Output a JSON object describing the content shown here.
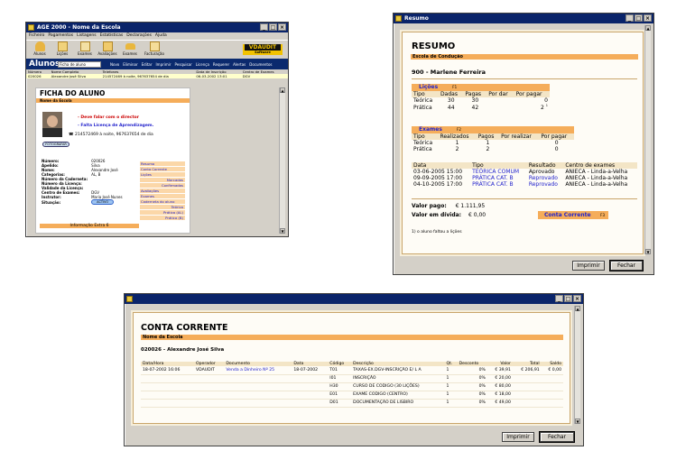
{
  "main": {
    "title": "AGE 2000 - Nome da Escola",
    "menu": [
      "Ficheiro",
      "Pagamentos",
      "Listagens",
      "Estatísticas",
      "Declarações",
      "Ajuda"
    ],
    "toolbar": [
      "Alunos",
      "Lições",
      "Exames",
      "Avaliações",
      "Exames",
      "Facturação"
    ],
    "logo": "VDAUDIT",
    "logo_sub": "Software",
    "section": "Alunos",
    "filter": "Ficha de aluno",
    "actions": [
      "Novo",
      "Eliminar",
      "Editar",
      "Imprimir",
      "Pesquisar",
      "Licença",
      "Requerer",
      "Alertas",
      "Documentos"
    ],
    "grid_headers": [
      "Número",
      "Nome Completo",
      "Telefones",
      "Data de Inscrição",
      "Centro de Exames"
    ],
    "grid_row": [
      "020026",
      "Alexandre José Silva",
      "214572469 à noite, 967637654 de dia",
      "06-03-2002 13:01",
      "DGV"
    ],
    "ficha": {
      "title": "FICHA DO ALUNO",
      "school": "Nome da Escola",
      "warn1": "- Deve falar com o director",
      "warn2": "- Falta Licença de Aprendizagem.",
      "phone": "214572469 à noite, 967637654 de dia",
      "photo_btn": "FOTOGRAFAR",
      "fields": [
        {
          "l": "Número:",
          "v": "020026"
        },
        {
          "l": "Apelido:",
          "v": "Silva"
        },
        {
          "l": "Nome:",
          "v": "Alexandre José"
        },
        {
          "l": "Categorias:",
          "v": "AL, B"
        },
        {
          "l": "Número da Caderneta:",
          "v": ""
        },
        {
          "l": "Número da Licença:",
          "v": ""
        },
        {
          "l": "Validade da Licença:",
          "v": ""
        },
        {
          "l": "Centro de Exames:",
          "v": "DGV"
        },
        {
          "l": "Instrutor:",
          "v": "Maria José Nunes"
        },
        {
          "l": "Situação:",
          "v": ""
        }
      ],
      "status": "ACTIVO",
      "links": [
        "Resumo",
        "Conta Corrente",
        "Lições",
        "Marcadas",
        "Confirmadas",
        "Avaliações",
        "Exames",
        "Caderneta do aluno",
        "Teórica",
        "Prática (AL)",
        "Prática (B)"
      ],
      "extra": "Informação Extra 6"
    }
  },
  "resumo": {
    "win_title": "Resumo",
    "title": "RESUMO",
    "school": "Escola de Condução",
    "student": "900 - Marlene Ferreira",
    "licoes_tab": "Lições",
    "licoes_key": "F1",
    "licoes_headers": [
      "Tipo",
      "Dadas",
      "Pagas",
      "Por dar",
      "Por pagar"
    ],
    "licoes_rows": [
      [
        "Teórica",
        "30",
        "30",
        "",
        "0"
      ],
      [
        "Prática",
        "44",
        "42",
        "",
        "2"
      ]
    ],
    "licoes_note": "1",
    "exames_tab": "Exames",
    "exames_key": "F2",
    "exames_headers": [
      "Tipo",
      "Realizados",
      "Pagos",
      "Por realizar",
      "Por pagar"
    ],
    "exames_rows": [
      [
        "Teórica",
        "1",
        "1",
        "",
        "0"
      ],
      [
        "Prática",
        "2",
        "2",
        "",
        "0"
      ]
    ],
    "hist_headers": [
      "Data",
      "Tipo",
      "Resultado",
      "Centro de exames"
    ],
    "hist_rows": [
      [
        "03-06-2005 15:00",
        "TEÓRICA COMUM",
        "Aprovado",
        "ANIECA - Linda-a-Velha"
      ],
      [
        "09-09-2005 17:00",
        "PRÁTICA CAT. B",
        "Reprovado",
        "ANIECA - Linda-a-Velha"
      ],
      [
        "04-10-2005 17:00",
        "PRÁTICA CAT. B",
        "Reprovado",
        "ANIECA - Linda-a-Velha"
      ]
    ],
    "pago_label": "Valor pago:",
    "pago": "€ 1.111,95",
    "divida_label": "Valor em dívida:",
    "divida": "€ 0,00",
    "cc_link": "Conta Corrente",
    "cc_key": "F3",
    "footnote": "1) o aluno faltou a lições",
    "btn_print": "Imprimir",
    "btn_close": "Fechar"
  },
  "conta": {
    "title": "CONTA CORRENTE",
    "school": "Nome da Escola",
    "student": "020026 - Alexandre José Silva",
    "headers": [
      "Data/Hora",
      "Operador",
      "Documento",
      "Data",
      "Código",
      "Descrição",
      "Qt.",
      "Desconto",
      "Valor",
      "Total",
      "Saldo"
    ],
    "rows": [
      [
        "18-07-2002 16:06",
        "VDAUDIT",
        "Venda a Dinheiro Nº 25",
        "18-07-2002",
        "T01",
        "TAXAS-EX.DGV-INSCRIÇÃO E/ L A",
        "1",
        "0%",
        "€ 39,91",
        "€ 206,91",
        "€ 0,00"
      ],
      [
        "",
        "",
        "",
        "",
        "I01",
        "INSCRIÇÃO",
        "1",
        "0%",
        "€ 20,00",
        "",
        ""
      ],
      [
        "",
        "",
        "",
        "",
        "H30",
        "CURSO DE CODIGO (30 LIÇÕES)",
        "1",
        "0%",
        "€ 80,00",
        "",
        ""
      ],
      [
        "",
        "",
        "",
        "",
        "E01",
        "EXAME CODIGO (CENTRO)",
        "1",
        "0%",
        "€ 18,00",
        "",
        ""
      ],
      [
        "",
        "",
        "",
        "",
        "D01",
        "DOCUMENTAÇÃO DE LISBIRO",
        "1",
        "0%",
        "€ 49,00",
        "",
        ""
      ]
    ],
    "btn_print": "Imprimir",
    "btn_close": "Fechar"
  },
  "colors": {
    "title_bar": "#0a246a",
    "orange": "#f5ad5a",
    "link_blue": "#2222cc",
    "warn_red": "#cc0000"
  }
}
